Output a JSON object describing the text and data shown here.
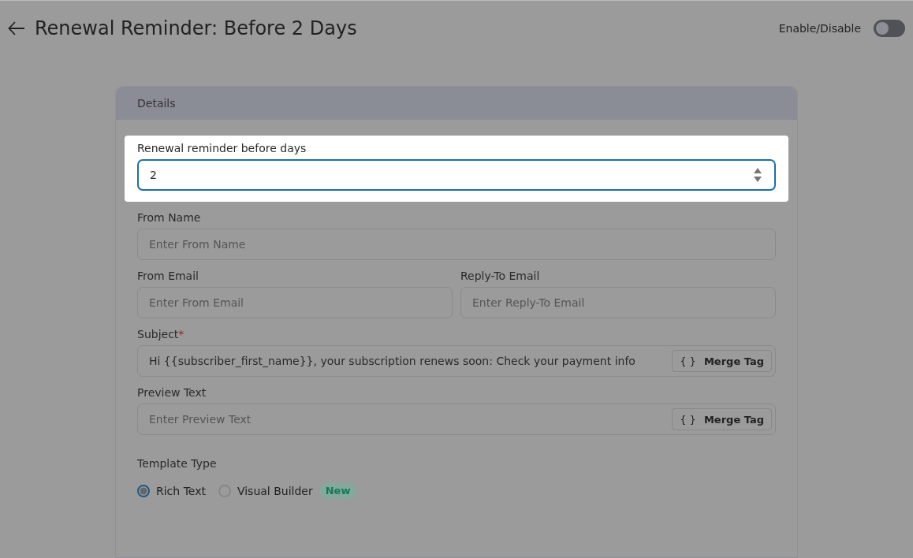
{
  "header": {
    "title": "Renewal Reminder: Before 2 Days",
    "toggle": {
      "label": "Enable/Disable",
      "on": false
    }
  },
  "card": {
    "title": "Details",
    "focused_panel": {
      "label": "Renewal reminder before days",
      "value": "2"
    },
    "rows": [
      {
        "fields": [
          {
            "kind": "text",
            "label": "From Name",
            "placeholder": "Enter From Name"
          }
        ]
      },
      {
        "fields": [
          {
            "kind": "text",
            "label": "From Email",
            "placeholder": "Enter From Email"
          },
          {
            "kind": "text",
            "label": "Reply-To Email",
            "placeholder": "Enter Reply-To Email"
          }
        ]
      },
      {
        "fields": [
          {
            "kind": "merge",
            "label": "Subject",
            "required_mark": "*",
            "value": "Hi {{subscriber_first_name}}, your subscription renews soon: Check your payment info",
            "button": {
              "icon": "{ }",
              "label": "Merge Tag"
            }
          }
        ]
      },
      {
        "fields": [
          {
            "kind": "merge",
            "label": "Preview Text",
            "placeholder": "Enter Preview Text",
            "button": {
              "icon": "{ }",
              "label": "Merge Tag"
            }
          }
        ]
      }
    ],
    "template_type": {
      "label": "Template Type",
      "options": [
        {
          "label": "Rich Text",
          "selected": true
        },
        {
          "label": "Visual Builder",
          "selected": false,
          "badge": "New"
        }
      ]
    }
  }
}
